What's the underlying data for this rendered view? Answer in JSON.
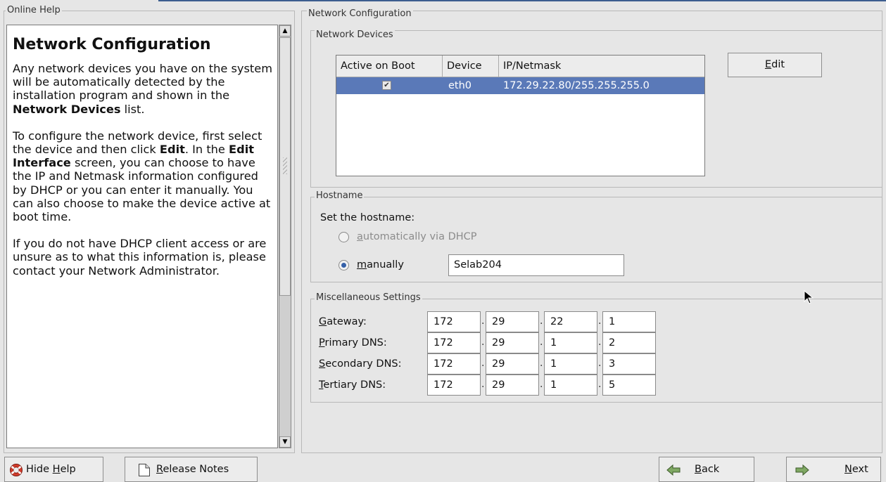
{
  "help_pane": {
    "frame_title": "Online Help",
    "heading": "Network Configuration",
    "p1_a": "Any network devices you have on the system will be automatically detected by the installation program and shown in the ",
    "p1_b": "Network Devices",
    "p1_c": " list.",
    "p2_a": "To configure the network device, first select the device and then click ",
    "p2_b": "Edit",
    "p2_c": ". In the ",
    "p2_d": "Edit Interface",
    "p2_e": " screen, you can choose to have the IP and Netmask information configured by DHCP or you can enter it manually. You can also choose to make the device active at boot time.",
    "p3": "If you do not have DHCP client access or are unsure as to what this information is, please contact your Network Administrator."
  },
  "network_config": {
    "frame_title": "Network Configuration",
    "devices": {
      "frame_title": "Network Devices",
      "columns": [
        "Active on Boot",
        "Device",
        "IP/Netmask"
      ],
      "rows": [
        {
          "active": true,
          "device": "eth0",
          "ip": "172.29.22.80/255.255.255.0"
        }
      ],
      "edit_button": {
        "pre": "",
        "mn": "E",
        "post": "dit"
      }
    },
    "hostname": {
      "frame_title": "Hostname",
      "prompt": "Set the hostname:",
      "auto": {
        "mn": "a",
        "post": "utomatically via DHCP",
        "selected": false
      },
      "manual": {
        "mn": "m",
        "post": "anually",
        "selected": true
      },
      "value": "Selab204"
    },
    "misc": {
      "frame_title": "Miscellaneous Settings",
      "rows": [
        {
          "mn": "G",
          "post": "ateway:",
          "octets": [
            "172",
            "29",
            "22",
            "1"
          ]
        },
        {
          "mn": "P",
          "post": "rimary DNS:",
          "octets": [
            "172",
            "29",
            "1",
            "2"
          ]
        },
        {
          "mn": "S",
          "post": "econdary DNS:",
          "octets": [
            "172",
            "29",
            "1",
            "3"
          ]
        },
        {
          "mn": "T",
          "post": "ertiary DNS:",
          "octets": [
            "172",
            "29",
            "1",
            "5"
          ]
        }
      ]
    }
  },
  "bottom": {
    "hide_help": {
      "pre": "Hide ",
      "mn": "H",
      "post": "elp"
    },
    "release_notes": {
      "mn": "R",
      "post": "elease Notes"
    },
    "back": {
      "mn": "B",
      "post": "ack"
    },
    "next": {
      "mn": "N",
      "post": "ext"
    }
  },
  "colors": {
    "selection": "#5a79b8",
    "accent": "#3c5d8f"
  }
}
